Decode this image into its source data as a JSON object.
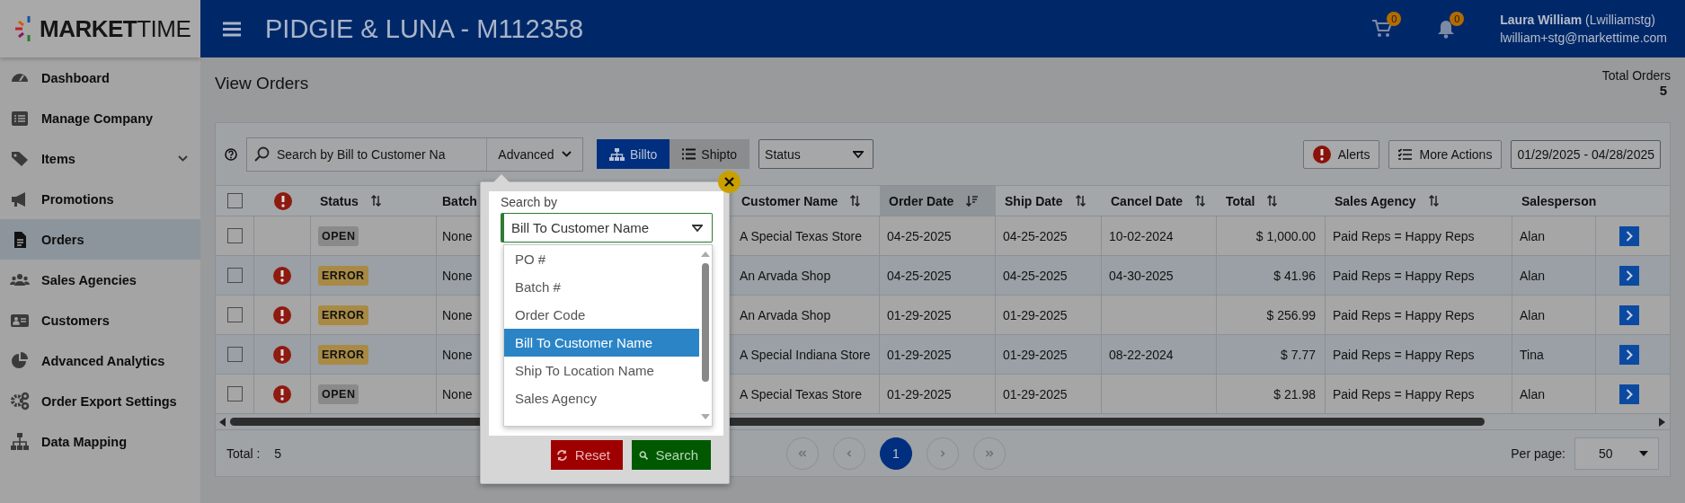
{
  "app": {
    "logo": "**MARKET**TIME",
    "title": "PIDGIE & LUNA - M112358",
    "cart_count": "0",
    "notification_count": "0",
    "user": {
      "name": "Laura William",
      "username": "(Lwilliamstg)",
      "email": "lwilliam+stg@markettime.com"
    }
  },
  "sidebar": {
    "items": [
      {
        "label": "Dashboard",
        "selected": false
      },
      {
        "label": "Manage Company",
        "selected": false
      },
      {
        "label": "Items",
        "selected": false,
        "expandable": true
      },
      {
        "label": "Promotions",
        "selected": false
      },
      {
        "label": "Orders",
        "selected": true
      },
      {
        "label": "Sales Agencies",
        "selected": false
      },
      {
        "label": "Customers",
        "selected": false
      },
      {
        "label": "Advanced Analytics",
        "selected": false
      },
      {
        "label": "Order Export Settings",
        "selected": false
      },
      {
        "label": "Data Mapping",
        "selected": false
      }
    ]
  },
  "page": {
    "title": "View Orders",
    "total_label": "Total Orders",
    "total_value": "5"
  },
  "toolbar": {
    "search_placeholder": "Search by Bill to Customer Na",
    "advanced": "Advanced",
    "view_toggle": [
      {
        "label": "Billto",
        "selected": true
      },
      {
        "label": "Shipto",
        "selected": false
      }
    ],
    "status_filter": "Status",
    "alerts": "Alerts",
    "more_actions": "More Actions",
    "date_range": "01/29/2025 - 04/28/2025"
  },
  "table": {
    "select_all": {
      "checked": false
    },
    "columns": [
      {
        "label": "Status",
        "sortable": true,
        "sorted": false
      },
      {
        "label": "Batch"
      },
      {
        "label": "Customer Name",
        "sortable": true,
        "sorted": false
      },
      {
        "label": "Order Date",
        "sortable": true,
        "sorted": true
      },
      {
        "label": "Ship Date",
        "sortable": true,
        "sorted": false
      },
      {
        "label": "Cancel Date",
        "sortable": true,
        "sorted": false
      },
      {
        "label": "Total",
        "sortable": true,
        "sorted": false
      },
      {
        "label": "Sales Agency",
        "sortable": true,
        "sorted": false
      },
      {
        "label": "Salesperson"
      }
    ],
    "rows": [
      {
        "checked": false,
        "alert": false,
        "status": {
          "label": "OPEN",
          "kind": "open"
        },
        "batch": "None",
        "customer_name": "A Special Texas Store",
        "order_date": "04-25-2025",
        "ship_date": "04-25-2025",
        "cancel_date": "10-02-2024",
        "total": "$ 1,000.00",
        "sales_agency": "Paid Reps = Happy Reps",
        "salesperson": "Alan"
      },
      {
        "checked": false,
        "alert": true,
        "status": {
          "label": "ERROR",
          "kind": "error"
        },
        "batch": "None",
        "customer_name": "An Arvada Shop",
        "order_date": "04-25-2025",
        "ship_date": "04-25-2025",
        "cancel_date": "04-30-2025",
        "total": "$ 41.96",
        "sales_agency": "Paid Reps = Happy Reps",
        "salesperson": "Alan"
      },
      {
        "checked": false,
        "alert": true,
        "status": {
          "label": "ERROR",
          "kind": "error"
        },
        "batch": "None",
        "customer_name": "An Arvada Shop",
        "order_date": "01-29-2025",
        "ship_date": "01-29-2025",
        "total": "$ 256.99",
        "sales_agency": "Paid Reps = Happy Reps",
        "salesperson": "Alan"
      },
      {
        "checked": false,
        "alert": true,
        "status": {
          "label": "ERROR",
          "kind": "error"
        },
        "batch": "None",
        "customer_name": "A Special Indiana Store",
        "order_date": "01-29-2025",
        "ship_date": "01-29-2025",
        "cancel_date": "08-22-2024",
        "total": "$ 7.77",
        "sales_agency": "Paid Reps = Happy Reps",
        "salesperson": "Tina"
      },
      {
        "checked": false,
        "alert": true,
        "status": {
          "label": "OPEN",
          "kind": "open"
        },
        "batch": "None",
        "customer_name": "A Special Texas Store",
        "order_date": "01-29-2025",
        "ship_date": "01-29-2025",
        "total": "$ 21.98",
        "sales_agency": "Paid Reps = Happy Reps",
        "salesperson": "Alan"
      }
    ]
  },
  "footer": {
    "total_label": "Total :",
    "total_value": "5",
    "pages": [
      {
        "label": "1",
        "selected": true
      }
    ],
    "per_page_label": "Per page:",
    "per_page": "50"
  },
  "popup": {
    "label": "Search by",
    "value": "Bill To Customer Name",
    "options": [
      {
        "label": "PO #",
        "selected": false
      },
      {
        "label": "Batch #",
        "selected": false
      },
      {
        "label": "Order Code",
        "selected": false
      },
      {
        "label": "Bill To Customer Name",
        "selected": true
      },
      {
        "label": "Ship To Location Name",
        "selected": false
      },
      {
        "label": "Sales Agency",
        "selected": false
      }
    ],
    "reset": "Reset",
    "search": "Search"
  }
}
